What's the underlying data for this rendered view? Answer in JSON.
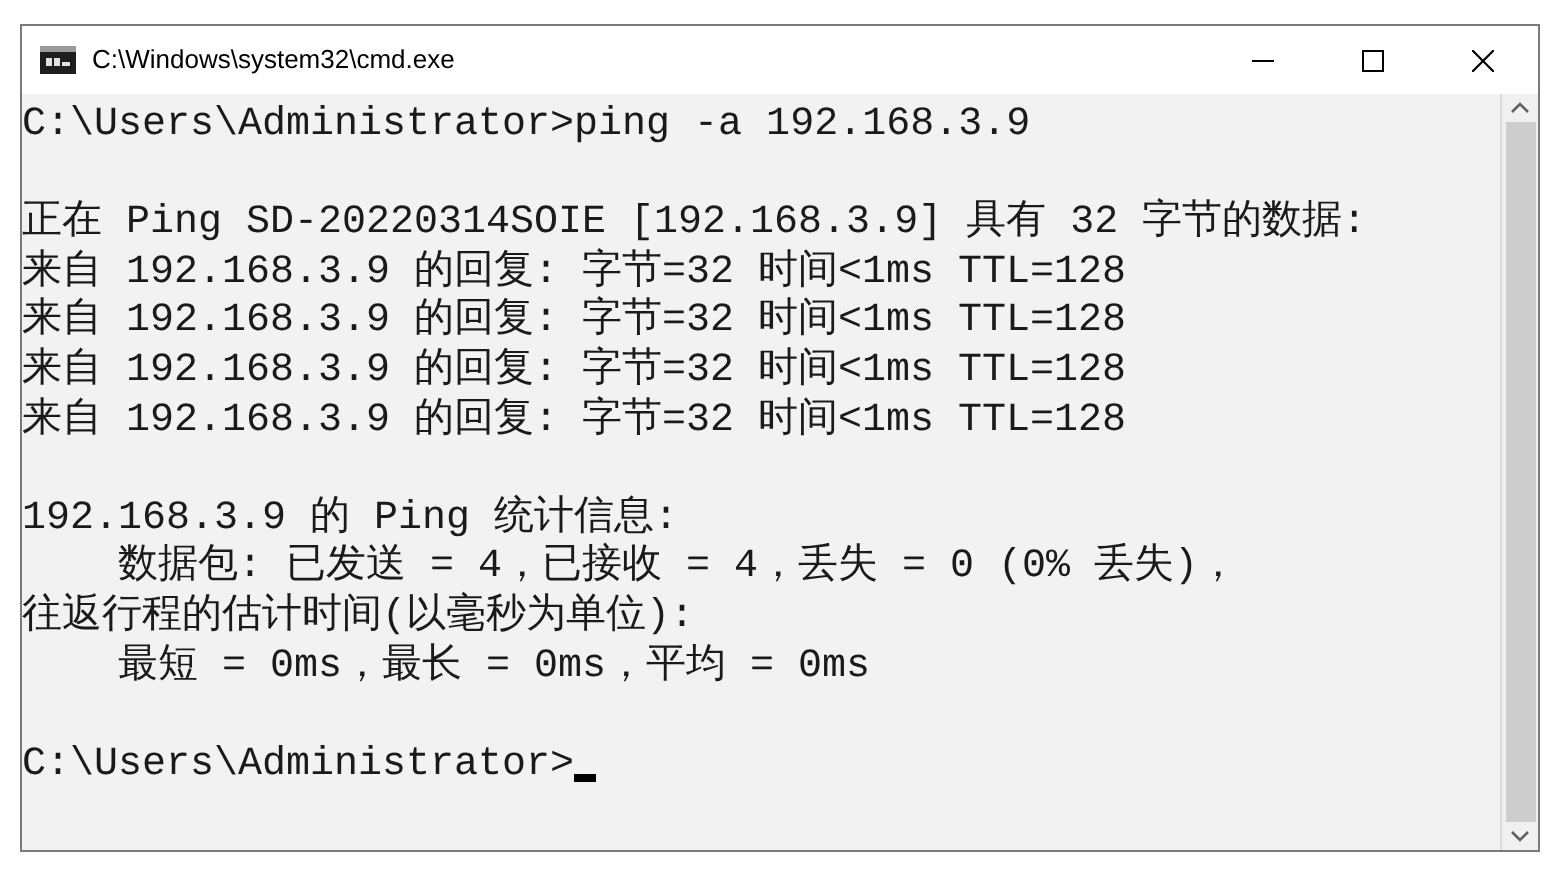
{
  "window": {
    "title": "C:\\Windows\\system32\\cmd.exe"
  },
  "console": {
    "blocks": [
      {
        "lines": [
          {
            "text": "C:\\Users\\Administrator>ping -a 192.168.3.9",
            "cursor": false
          }
        ]
      },
      {
        "lines": [
          {
            "text": "正在 Ping SD-20220314SOIE [192.168.3.9] 具有 32 字节的数据:",
            "cursor": false
          },
          {
            "text": "来自 192.168.3.9 的回复: 字节=32 时间<1ms TTL=128",
            "cursor": false
          },
          {
            "text": "来自 192.168.3.9 的回复: 字节=32 时间<1ms TTL=128",
            "cursor": false
          },
          {
            "text": "来自 192.168.3.9 的回复: 字节=32 时间<1ms TTL=128",
            "cursor": false
          },
          {
            "text": "来自 192.168.3.9 的回复: 字节=32 时间<1ms TTL=128",
            "cursor": false
          }
        ]
      },
      {
        "lines": [
          {
            "text": "192.168.3.9 的 Ping 统计信息:",
            "cursor": false
          },
          {
            "text": "    数据包: 已发送 = 4，已接收 = 4，丢失 = 0 (0% 丢失)，",
            "cursor": false
          },
          {
            "text": "往返行程的估计时间(以毫秒为单位):",
            "cursor": false
          },
          {
            "text": "    最短 = 0ms，最长 = 0ms，平均 = 0ms",
            "cursor": false
          }
        ]
      },
      {
        "lines": [
          {
            "text": "C:\\Users\\Administrator>",
            "cursor": true
          }
        ]
      }
    ]
  }
}
